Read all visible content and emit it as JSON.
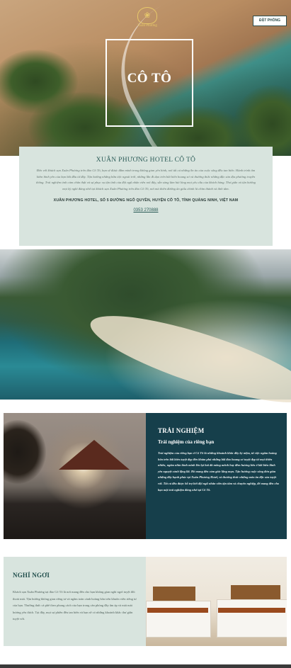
{
  "header": {
    "logo_text": "Xuân Phương",
    "book_button": "ĐẶT PHÒNG",
    "hero_title": "CÔ TÔ"
  },
  "info": {
    "heading": "XUÂN PHƯƠNG HOTEL CÔ TÔ",
    "description": "Đến với khách sạn Xuân Phương trên đảo Cô Tô, bạn sẽ được đắm mình trong không gian yên bình, nơi tất cả những ồn ào của cuộc sống đều tan biến. Hành trình tìm kiếm bình yên của bạn bắt đầu từ đây. Tận hưởng những bữa tiệc ngoài trời, những lần đi dạo trên bãi biển hoang sơ và thưởng thức những đặc sản địa phương truyền thống. Trải nghiệm tinh cảm chân thật và sự phục vụ tận tình của đội ngũ nhân viên nơi đây, sẵn sàng làm hài lòng mọi yêu cầu của khách hàng. Thư giãn và tận hưởng mọi kỳ nghỉ đáng nhớ tại khách sạn Xuân Phương trên đảo Cô Tô, nơi mà thiên đường ẩn giấu chính là chìm thành và tĩnh tâm.",
    "address": "XUÂN PHƯƠNG HOTEL, SỐ 5 ĐƯỜNG NGÔ QUYỀN, HUYỆN CÔ TÔ, TỈNH QUẢNG NINH, VIỆT NAM",
    "phone": "0353 270888"
  },
  "experience": {
    "title": "TRẢI NGHIỆM",
    "subtitle": "Trải nghiệm của riêng bạn",
    "body": "Trải nghiệm của riêng bạn ở Cô Tô là những khoảnh khắc đầy kỷ niệm, từ việc ngắm hoàng hôn trên bãi biển tuyệt đẹp đến khám phá những bãi đảo hoang sơ tuyệt đẹp từ mọi thiên nhiên, ngắm nhìn bình minh lên lại hải đá mông mênh hay đêm hương bên ở bãi biển lãnh yên nguyệt cảnh lặng lãi. Hổ mang đến cảm giác lãng mạn. Tận hưởng cuộc sống đơn giản những đầy hạnh phúc tại Xuân Phương Hotel, và thưởng thức những món ăn đặc sản tuyệt vời. Tất cả đều được hỗ trợ bởi đội ngũ nhân viên tận tâm và chuyên nghiệp, để mang đến cho bạn một trải nghiệm đáng nhớ tại Cô Tô."
  },
  "rest": {
    "title": "NGHỈ NGƠI",
    "body": "Khách sạn Xuân Phương tại đảo Cô Tô là nơi mang đến cho bạn không gian nghỉ ngơi tuyệt đối thoải mái. Tận hưởng không gian riêng tư và ngắm toàn cảnh hoàng hôn trên khuôn viên riêng tư của bạn. Thưởng thức cà phê theo phong cách của bạn trong căn phòng đầy ấm áp và mát mát hương yêu thích. Tại đây, mọi sự phiền đều tan biến và bạn sẽ có những khoảnh khắc thư giãn tuyệt vời."
  }
}
